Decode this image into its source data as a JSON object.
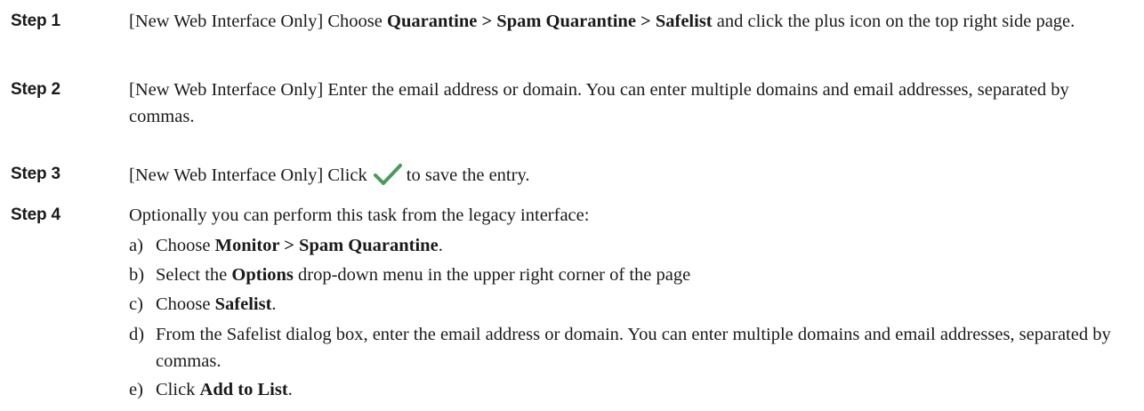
{
  "steps": [
    {
      "label": "Step 1",
      "prefix": "[New Web Interface Only] Choose ",
      "bold": "Quarantine > Spam Quarantine > Safelist",
      "suffix": " and click the plus icon on the top right side page."
    },
    {
      "label": "Step 2",
      "text": "[New Web Interface Only] Enter the email address or domain. You can enter multiple domains and email addresses, separated by commas."
    },
    {
      "label": "Step 3",
      "prefix": "[New Web Interface Only] Click",
      "icon": "checkmark-icon",
      "suffix": "to save the entry."
    },
    {
      "label": "Step 4",
      "text": "Optionally you can perform this task from the legacy interface:"
    }
  ],
  "substeps": [
    {
      "letter": "a)",
      "prefix": "Choose ",
      "bold": "Monitor > Spam Quarantine",
      "suffix": "."
    },
    {
      "letter": "b)",
      "prefix": "Select the ",
      "bold": "Options",
      "suffix": " drop-down menu in the upper right corner of the page"
    },
    {
      "letter": "c)",
      "prefix": "Choose ",
      "bold": "Safelist",
      "suffix": "."
    },
    {
      "letter": "d)",
      "text": "From the Safelist dialog box, enter the email address or domain. You can enter multiple domains and email addresses, separated by commas."
    },
    {
      "letter": "e)",
      "prefix": "Click ",
      "bold": "Add to List",
      "suffix": "."
    }
  ],
  "colors": {
    "text": "#1a1a1a",
    "checkmark": "#4a9a5c"
  }
}
